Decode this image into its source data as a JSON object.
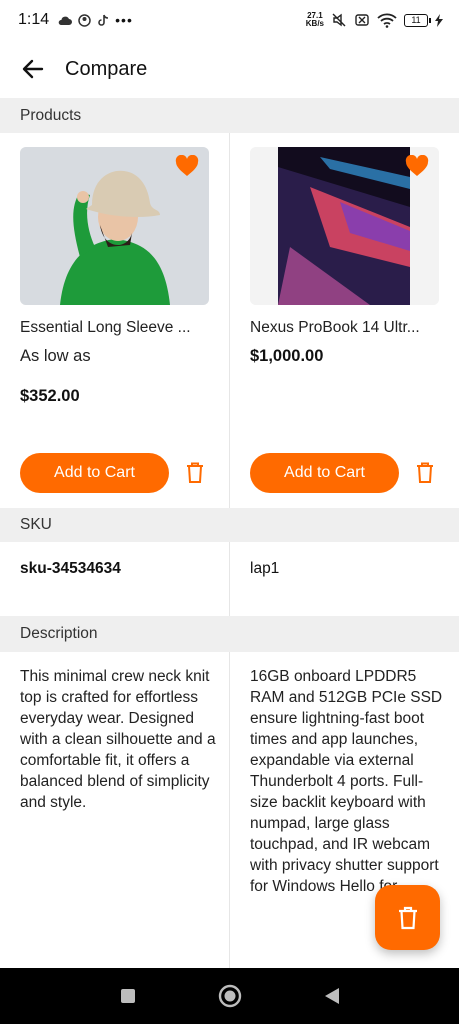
{
  "status_bar": {
    "time": "1:14",
    "netspeed_value": "27.1",
    "netspeed_unit": "KB/s",
    "battery": "11"
  },
  "header": {
    "title": "Compare"
  },
  "sections": {
    "products": "Products",
    "sku": "SKU",
    "description": "Description"
  },
  "products": [
    {
      "name": "Essential Long Sleeve ...",
      "price_prefix": "As low as",
      "price": "$352.00",
      "add_to_cart": "Add to Cart",
      "sku": "sku-34534634",
      "description": "This minimal crew neck knit top is crafted for effortless everyday wear. Designed with a clean silhouette and a comfortable fit, it offers a balanced blend of simplicity and style."
    },
    {
      "name": "Nexus ProBook 14 Ultr...",
      "price": "$1,000.00",
      "add_to_cart": "Add to Cart",
      "sku": "lap1",
      "description": "16GB onboard LPDDR5 RAM and 512GB PCIe SSD ensure lightning-fast boot times and app launches, expandable via external Thunderbolt 4 ports. Full-size backlit keyboard with numpad, large glass touchpad, and IR webcam with privacy shutter support for Windows Hello for"
    }
  ],
  "colors": {
    "accent": "#ff6a00",
    "section_bg": "#efefef"
  }
}
